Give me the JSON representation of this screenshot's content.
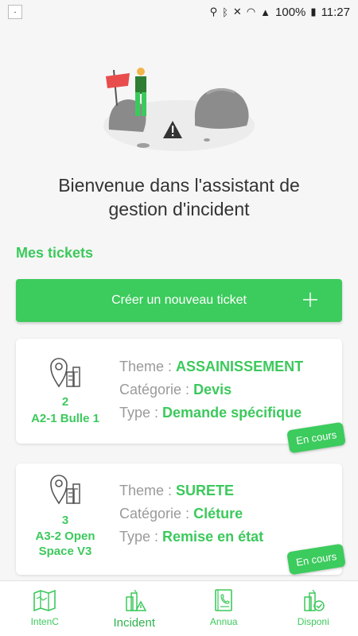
{
  "statusbar": {
    "battery": "100%",
    "time": "11:27"
  },
  "welcome": {
    "line1": "Bienvenue dans l'assistant de",
    "line2": "gestion d'incident"
  },
  "tickets_section": {
    "title": "Mes tickets",
    "create_label": "Créer un nouveau ticket"
  },
  "tickets": [
    {
      "number": "2",
      "place": "A2-1 Bulle 1",
      "theme_label": "Theme :",
      "theme": "ASSAINISSEMENT",
      "category_label": "Catégorie :",
      "category": "Devis",
      "type_label": "Type :",
      "type": "Demande spécifique",
      "status": "En cours"
    },
    {
      "number": "3",
      "place_line1": "A3-2 Open",
      "place_line2": "Space V3",
      "theme_label": "Theme :",
      "theme": "SURETE",
      "category_label": "Catégorie :",
      "category": "Cléture",
      "type_label": "Type :",
      "type": "Remise en état",
      "status": "En cours"
    }
  ],
  "bottom_nav": [
    {
      "label": "IntenC",
      "icon": "map-icon"
    },
    {
      "label": "Incident",
      "icon": "incident-icon"
    },
    {
      "label": "Annua",
      "icon": "directory-icon"
    },
    {
      "label": "Disponi",
      "icon": "availability-icon"
    }
  ],
  "colors": {
    "accent": "#3ccb5d",
    "background": "#f6f6f6"
  }
}
